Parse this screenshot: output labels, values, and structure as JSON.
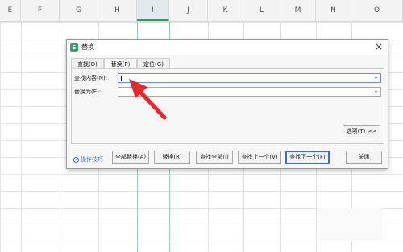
{
  "spreadsheet": {
    "columns": [
      "E",
      "F",
      "G",
      "H",
      "I",
      "J",
      "K",
      "L",
      "M",
      "N",
      "O"
    ],
    "selected_column": "I"
  },
  "dialog": {
    "title": "替换",
    "app_icon": "S",
    "tabs": [
      {
        "label": "查找(D)"
      },
      {
        "label": "替换(P)"
      },
      {
        "label": "定位(G)"
      }
    ],
    "find_label": "查找内容(N):",
    "find_value": "",
    "replace_label": "替换为(E):",
    "replace_value": "",
    "options_button": "选项(T) >>",
    "tips_link": "操作技巧",
    "buttons": {
      "replace_all": "全部替换(A)",
      "replace": "替换(R)",
      "find_all": "查找全部(I)",
      "find_prev": "查找上一个(V)",
      "find_next": "查找下一个(F)",
      "close": "关闭"
    }
  },
  "colors": {
    "accent_green": "#2fa36b",
    "primary_border": "#3c6fd6",
    "annotation_arrow": "#e8282b"
  },
  "icons": [
    "app-s-icon",
    "close-icon",
    "chevron-down-icon",
    "play-circle-icon",
    "red-arrow-annotation"
  ]
}
